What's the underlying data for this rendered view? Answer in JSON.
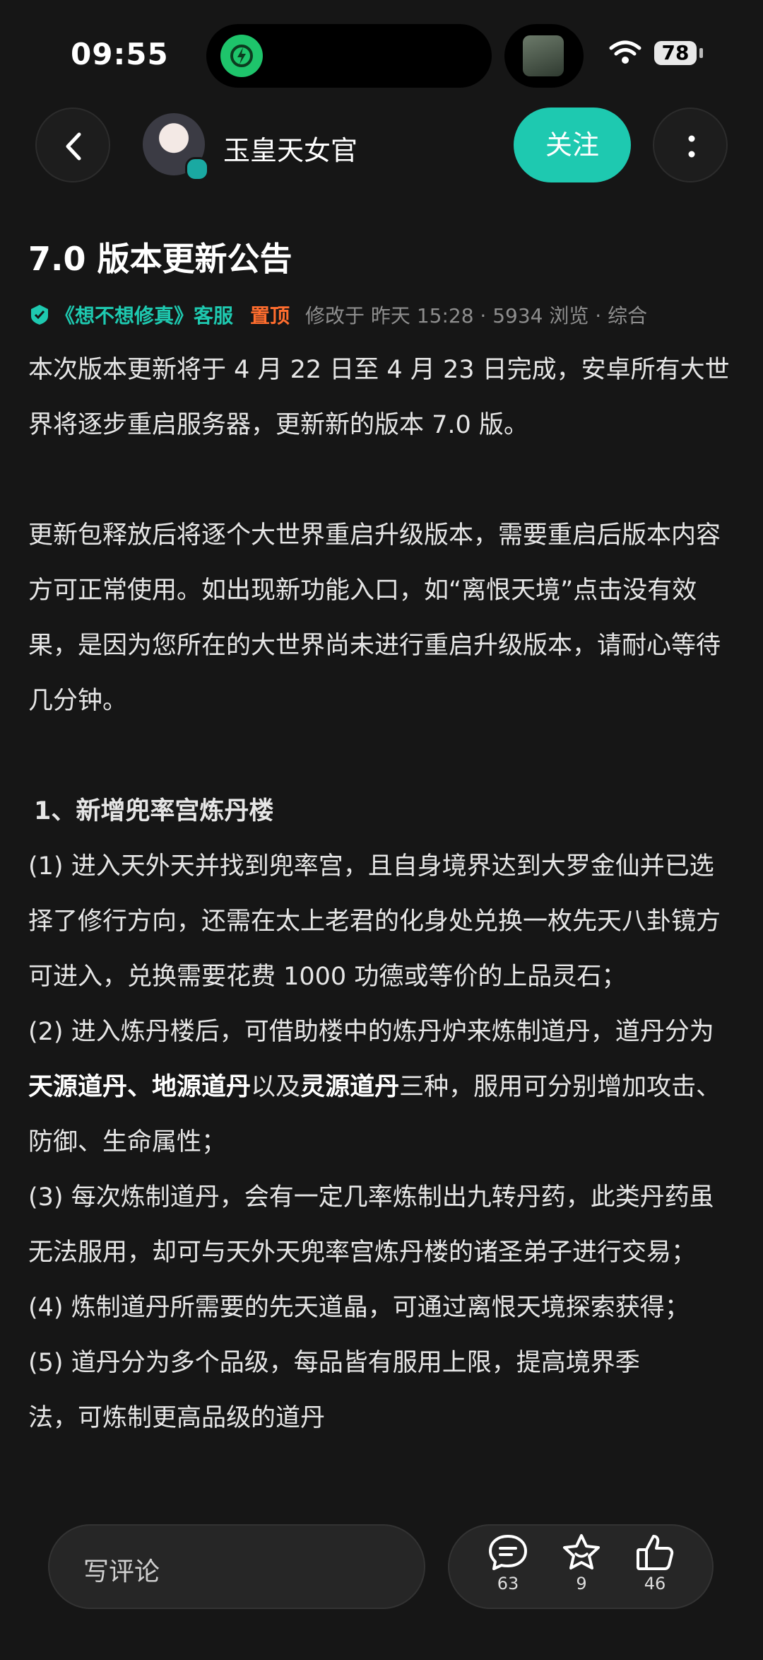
{
  "status_bar": {
    "time": "09:55",
    "battery": "78"
  },
  "header": {
    "username": "玉皇天女官",
    "follow_label": "关注"
  },
  "article": {
    "title": "7.0 版本更新公告",
    "meta": {
      "source": "《想不想修真》客服",
      "pinned": "置顶",
      "info": "修改于 昨天 15:28 · 5934 浏览 · 综合"
    },
    "paragraphs": {
      "p1": "本次版本更新将于 4 月 22 日至 4 月 23 日完成，安卓所有大世界将逐步重启服务器，更新新的版本 7.0 版。",
      "p2": "更新包释放后将逐个大世界重启升级版本，需要重启后版本内容方可正常使用。如出现新功能入口，如“离恨天境”点击没有效果，是因为您所在的大世界尚未进行重启升级版本，请耐心等待几分钟。",
      "section1": "1、新增兜率宫炼丹楼",
      "item1": "(1) 进入天外天并找到兜率宫，且自身境界达到大罗金仙并已选择了修行方向，还需在太上老君的化身处兑换一枚先天八卦镜方可进入，兑换需要花费 1000 功德或等价的上品灵石；",
      "item2_a": "(2) 进入炼丹楼后，可借助楼中的炼丹炉来炼制道丹，道丹分为",
      "item2_b1": "天源道丹",
      "item2_sep1": "、",
      "item2_b2": "地源道丹",
      "item2_mid": "以及",
      "item2_b3": "灵源道丹",
      "item2_c": "三种，服用可分别增加攻击、防御、生命属性；",
      "item3": "(3) 每次炼制道丹，会有一定几率炼制出九转丹药，此类丹药虽无法服用，却可与天外天兜率宫炼丹楼的诸圣弟子进行交易；",
      "item4": "(4) 炼制道丹所需要的先天道晶，可通过离恨天境探索获得；",
      "item5": "(5) 道丹分为多个品级，每品皆有服用上限，提高境界季",
      "item5_tail": "法，可炼制更高品级的道丹"
    }
  },
  "bottom_bar": {
    "comment_placeholder": "写评论",
    "comments_count": "63",
    "favorites_count": "9",
    "likes_count": "46"
  }
}
